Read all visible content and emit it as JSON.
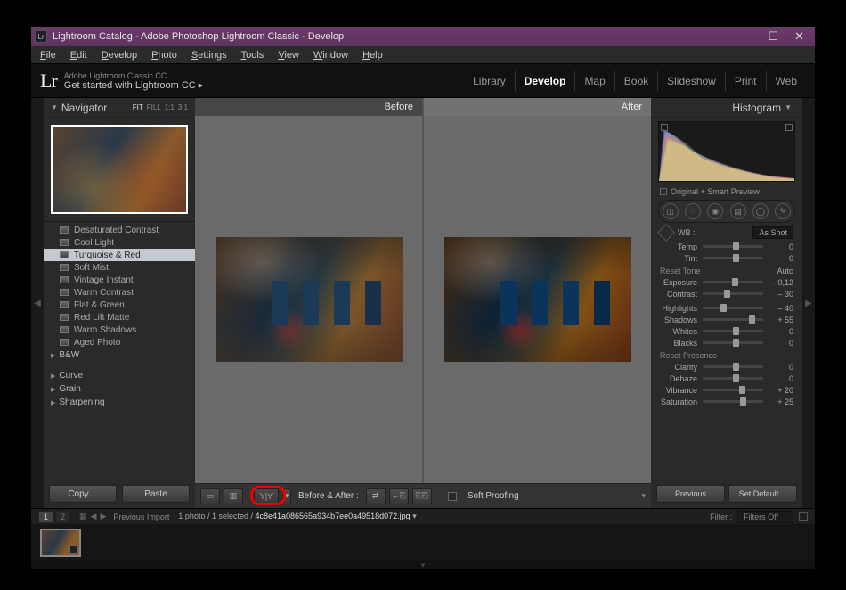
{
  "window_title": "Lightroom Catalog - Adobe Photoshop Lightroom Classic - Develop",
  "menubar": [
    "File",
    "Edit",
    "Develop",
    "Photo",
    "Settings",
    "Tools",
    "View",
    "Window",
    "Help"
  ],
  "header": {
    "logo": "Lr",
    "subtitle1": "Adobe Lightroom Classic CC",
    "subtitle2": "Get started with Lightroom CC  ▸"
  },
  "modules": [
    "Library",
    "Develop",
    "Map",
    "Book",
    "Slideshow",
    "Print",
    "Web"
  ],
  "active_module": "Develop",
  "navigator": {
    "title": "Navigator",
    "opts": [
      "FIT",
      "FILL",
      "1:1",
      "3:1"
    ]
  },
  "presets": {
    "items": [
      "Desaturated Contrast",
      "Cool Light",
      "Turquoise & Red",
      "Soft Mist",
      "Vintage Instant",
      "Warm Contrast",
      "Flat & Green",
      "Red Lift Matte",
      "Warm Shadows",
      "Aged Photo"
    ],
    "selected": "Turquoise & Red",
    "groups": [
      "B&W",
      "Curve",
      "Grain",
      "Sharpening"
    ]
  },
  "copy_label": "Copy…",
  "paste_label": "Paste",
  "before_label": "Before",
  "after_label": "After",
  "toolbar_label": "Before & After :",
  "soft_proof": "Soft Proofing",
  "histogram": {
    "title": "Histogram",
    "preview": "Original + Smart Preview"
  },
  "wb": {
    "label": "WB :",
    "value": "As Shot"
  },
  "sliders_wb": [
    {
      "name": "Temp",
      "value": "0",
      "pos": 50
    },
    {
      "name": "Tint",
      "value": "0",
      "pos": 50
    }
  ],
  "reset_tone": "Reset Tone",
  "auto": "Auto",
  "sliders_tone": [
    {
      "name": "Exposure",
      "value": "– 0,12",
      "pos": 48
    },
    {
      "name": "Contrast",
      "value": "– 30",
      "pos": 35
    }
  ],
  "sliders_tone2": [
    {
      "name": "Highlights",
      "value": "– 40",
      "pos": 30
    },
    {
      "name": "Shadows",
      "value": "+ 55",
      "pos": 77
    },
    {
      "name": "Whites",
      "value": "0",
      "pos": 50
    },
    {
      "name": "Blacks",
      "value": "0",
      "pos": 50
    }
  ],
  "reset_presence": "Reset Presence",
  "sliders_presence": [
    {
      "name": "Clarity",
      "value": "0",
      "pos": 50
    },
    {
      "name": "Dehaze",
      "value": "0",
      "pos": 50
    },
    {
      "name": "Vibrance",
      "value": "+ 20",
      "pos": 60
    },
    {
      "name": "Saturation",
      "value": "+ 25",
      "pos": 62
    }
  ],
  "previous_label": "Previous",
  "defaults_label": "Set Default…",
  "filmstrip": {
    "prev_import": "Previous Import",
    "count": "1 photo / 1 selected /",
    "filename": "4c8e41a086565a934b7ee0a49518d072.jpg",
    "filter_label": "Filter :",
    "filter_value": "Filters Off"
  }
}
